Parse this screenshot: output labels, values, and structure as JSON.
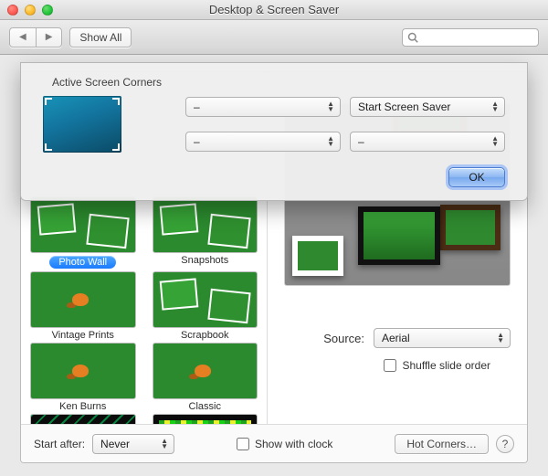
{
  "window": {
    "title": "Desktop & Screen Saver"
  },
  "toolbar": {
    "show_all": "Show All",
    "search_placeholder": ""
  },
  "sheet": {
    "title": "Active Screen Corners",
    "corners": {
      "top_left": "–",
      "top_right": "Start Screen Saver",
      "bottom_left": "–",
      "bottom_right": "–"
    },
    "ok": "OK"
  },
  "savers": [
    {
      "key": "photo-wall",
      "label": "Photo Wall",
      "selected": true
    },
    {
      "key": "snapshots",
      "label": "Snapshots",
      "selected": false
    },
    {
      "key": "vintage-prints",
      "label": "Vintage Prints",
      "selected": false
    },
    {
      "key": "scrapbook",
      "label": "Scrapbook",
      "selected": false
    },
    {
      "key": "ken-burns",
      "label": "Ken Burns",
      "selected": false
    },
    {
      "key": "classic",
      "label": "Classic",
      "selected": false
    }
  ],
  "source": {
    "label": "Source:",
    "value": "Aerial"
  },
  "shuffle": {
    "label": "Shuffle slide order",
    "checked": false
  },
  "bottom": {
    "start_after_label": "Start after:",
    "start_after_value": "Never",
    "show_clock_label": "Show with clock",
    "show_clock_checked": false,
    "hot_corners": "Hot Corners…"
  }
}
